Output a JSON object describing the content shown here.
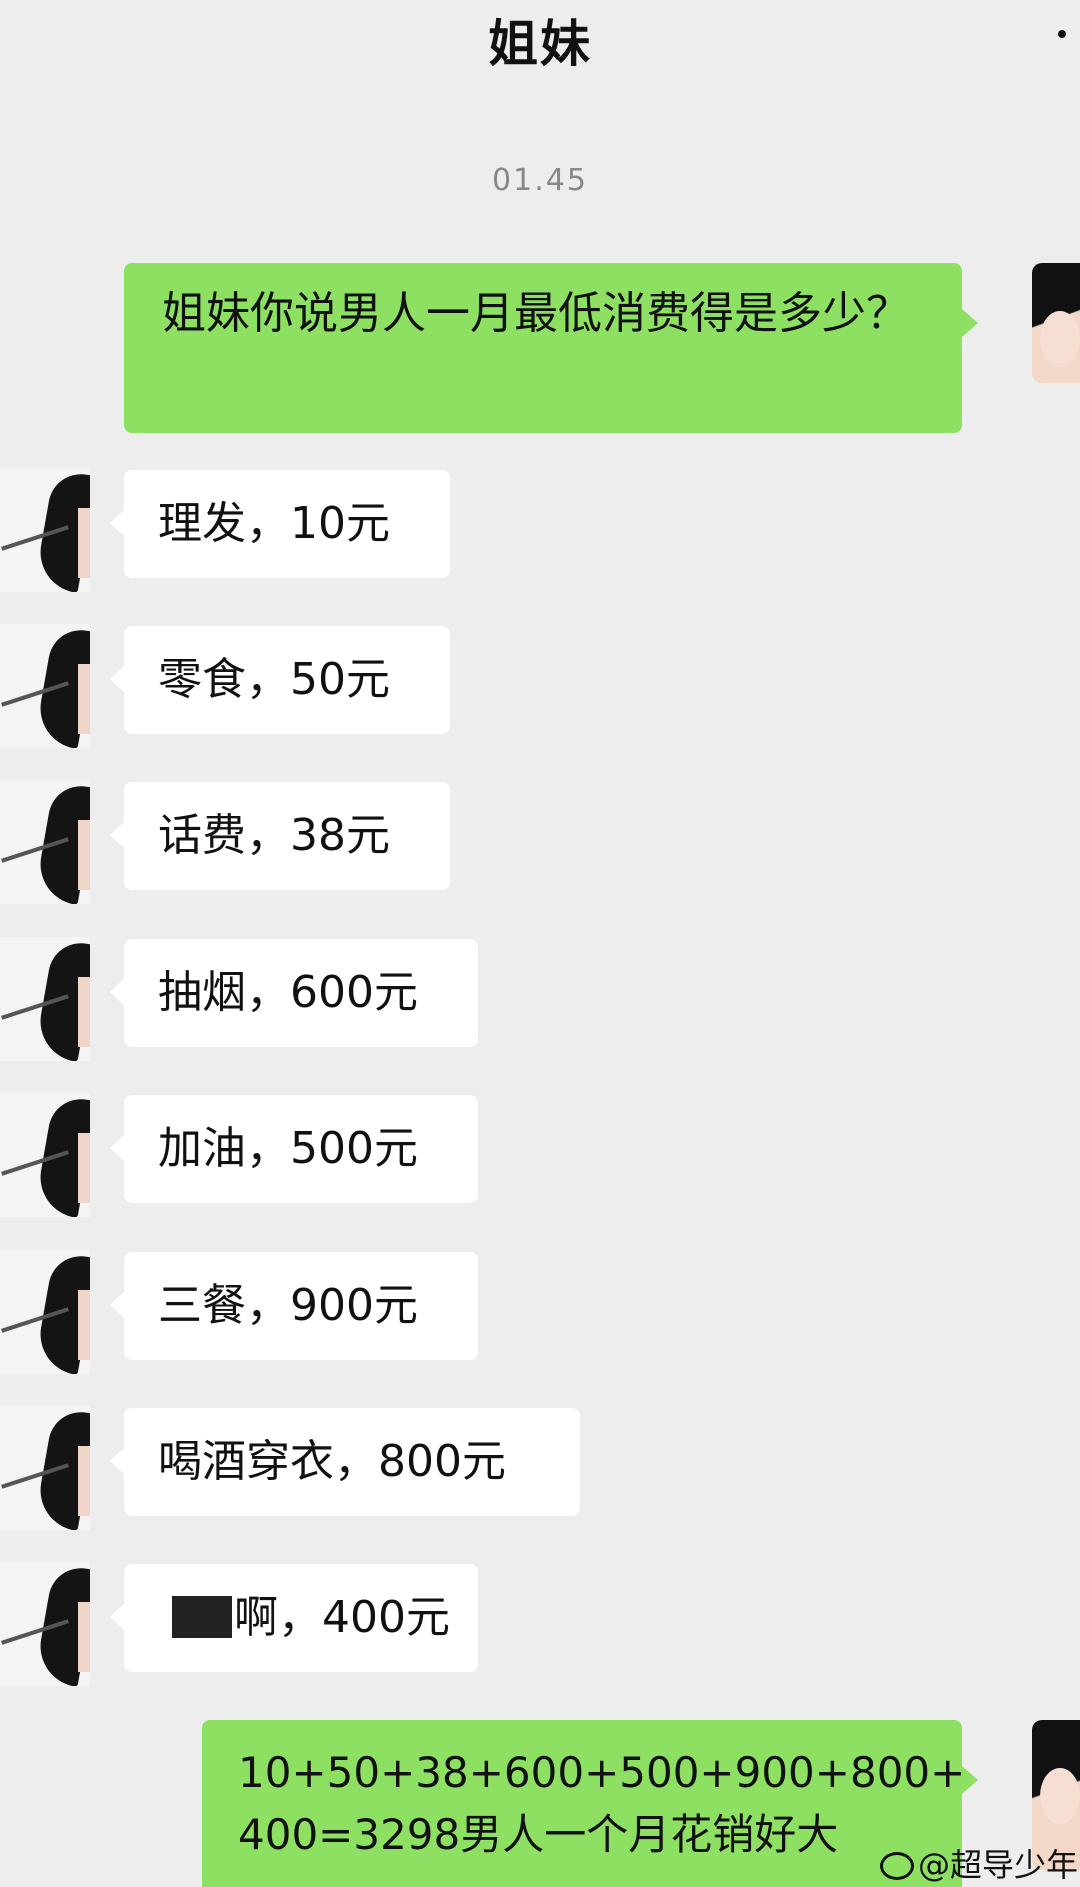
{
  "header": {
    "title": "姐妹"
  },
  "chat": {
    "timestamp": "01.45",
    "first_question": "姐妹你说男人一月最低消费得是多少？",
    "replies": [
      "理发，10元",
      "零食，50元",
      "话费，38元",
      "抽烟，600元",
      "加油，500元",
      "三餐，900元",
      "喝酒穿衣，800元"
    ],
    "censored_reply_suffix": "啊，400元",
    "final_message_line1": "10+50+38+600+500+900+800+",
    "final_message_line2": "400=3298男人一个月花销好大"
  },
  "watermark": {
    "text": "@超导少年"
  }
}
